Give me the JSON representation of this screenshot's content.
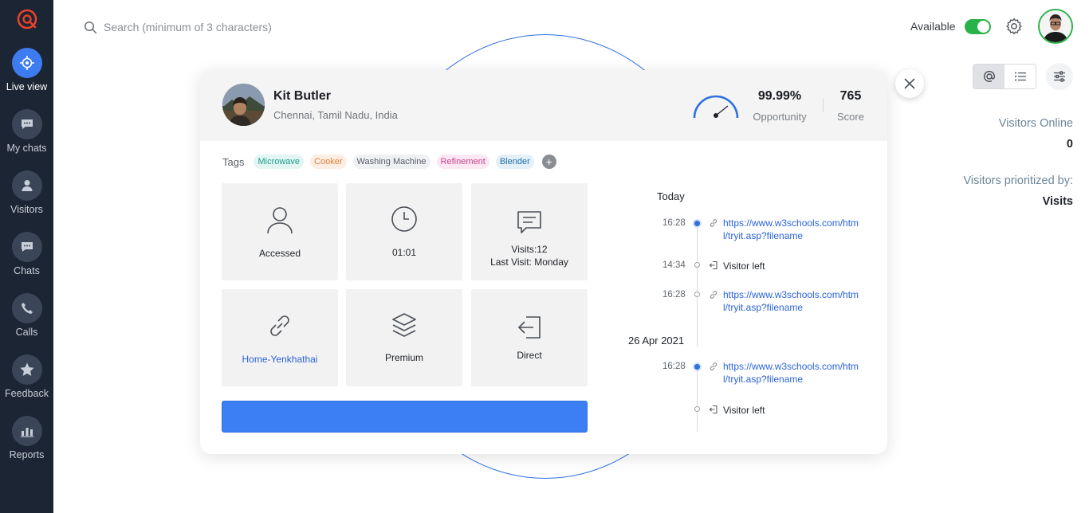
{
  "search": {
    "placeholder": "Search (minimum of 3 characters)"
  },
  "sidebar": {
    "items": [
      {
        "label": "Live view",
        "icon": "crosshair-icon"
      },
      {
        "label": "My chats",
        "icon": "chat-bubble-icon"
      },
      {
        "label": "Visitors",
        "icon": "person-icon"
      },
      {
        "label": "Chats",
        "icon": "chat-bubble-icon"
      },
      {
        "label": "Calls",
        "icon": "phone-icon"
      },
      {
        "label": "Feedback",
        "icon": "star-icon"
      },
      {
        "label": "Reports",
        "icon": "bar-chart-icon"
      }
    ]
  },
  "topbar": {
    "status_label": "Available",
    "status_on": true
  },
  "right_panel": {
    "visitors_online_label": "Visitors Online",
    "visitors_online_value": "0",
    "prioritized_label": "Visitors prioritized by:",
    "prioritized_value": "Visits"
  },
  "visitor": {
    "name": "Kit Butler",
    "location": "Chennai, Tamil Nadu, India",
    "opportunity_value": "99.99%",
    "opportunity_label": "Opportunity",
    "score_value": "765",
    "score_label": "Score"
  },
  "tags": {
    "label": "Tags",
    "items": [
      {
        "text": "Microwave",
        "color": "#1a9e8f",
        "bg": "#e3f5f2"
      },
      {
        "text": "Cooker",
        "color": "#e0813a",
        "bg": "#fdeee3"
      },
      {
        "text": "Washing Machine",
        "color": "#5a5f66",
        "bg": "#eef0f2"
      },
      {
        "text": "Refinement",
        "color": "#c8418f",
        "bg": "#fbe8f2"
      },
      {
        "text": "Blender",
        "color": "#1f6fa8",
        "bg": "#e3f0f8"
      }
    ]
  },
  "tiles": {
    "accessed": "Accessed",
    "duration": "01:01",
    "visits": "Visits:12",
    "last_visit": "Last Visit: Monday",
    "page": "Home-Yenkhathai",
    "plan": "Premium",
    "source": "Direct"
  },
  "timeline": {
    "groups": [
      {
        "date": "Today",
        "events": [
          {
            "time": "16:28",
            "type": "link",
            "text": "https://www.w3schools.com/html/tryit.asp?filename"
          },
          {
            "time": "14:34",
            "type": "left",
            "text": "Visitor left"
          },
          {
            "time": "16:28",
            "type": "link",
            "text": "https://www.w3schools.com/html/tryit.asp?filename"
          }
        ]
      },
      {
        "date": "26 Apr 2021",
        "events": [
          {
            "time": "16:28",
            "type": "link",
            "text": "https://www.w3schools.com/html/tryit.asp?filename"
          },
          {
            "time": "",
            "type": "left",
            "text": "Visitor left"
          }
        ]
      }
    ]
  }
}
